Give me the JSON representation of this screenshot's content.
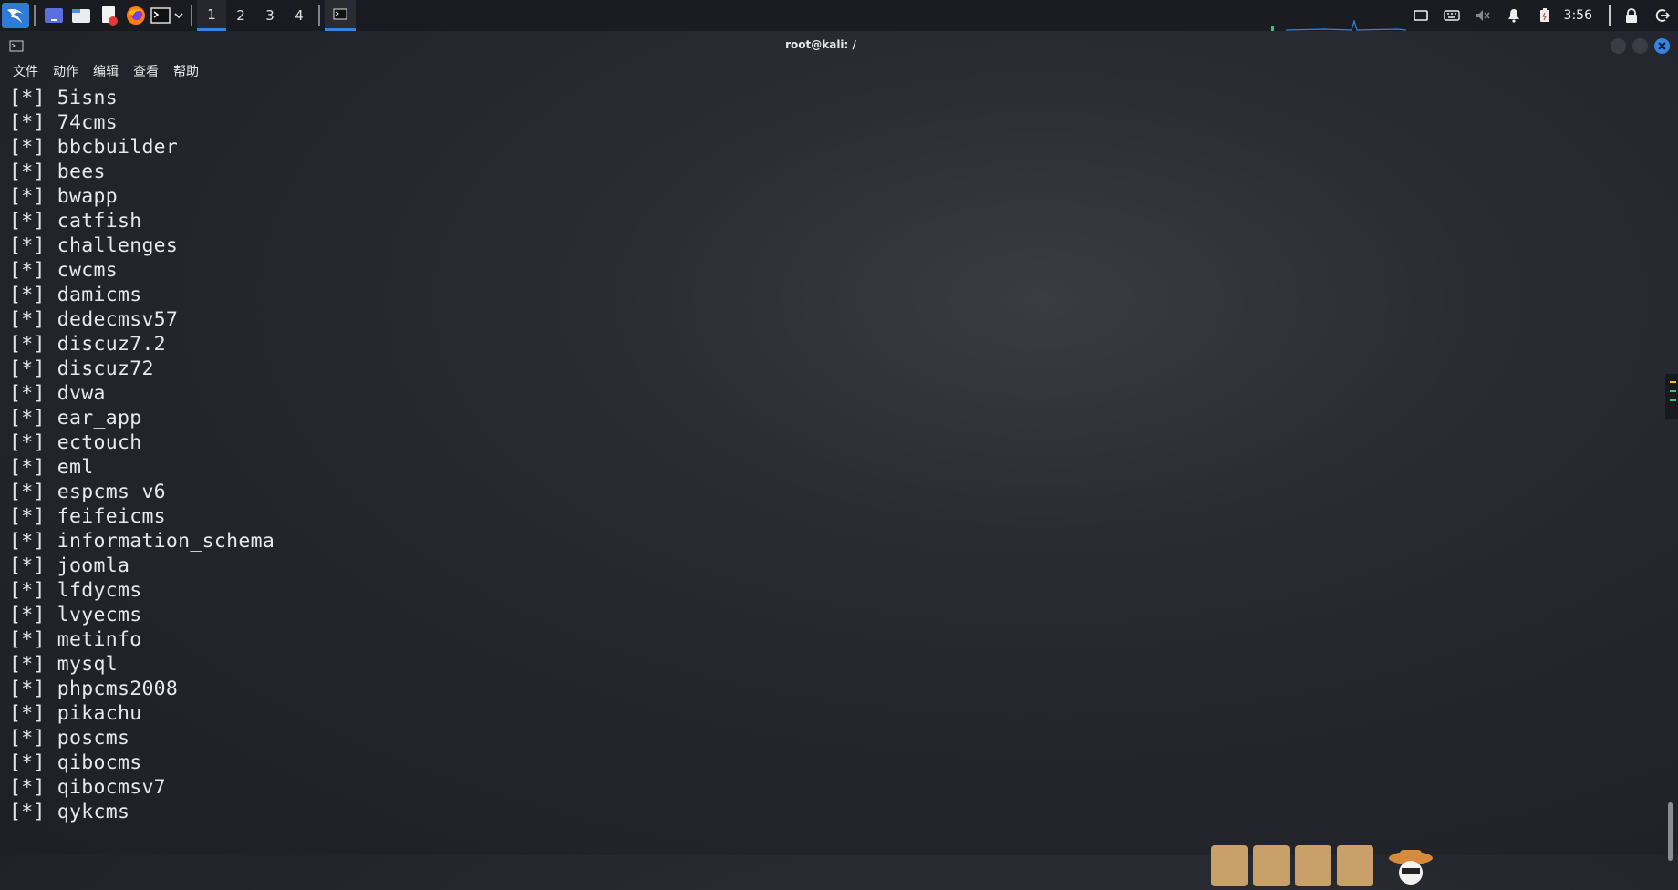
{
  "taskbar": {
    "workspaces": [
      "1",
      "2",
      "3",
      "4"
    ],
    "active_workspace": "1",
    "clock": "3:56",
    "accent_color": "#3584e4"
  },
  "window": {
    "title": "root@kali: /",
    "menu": [
      "文件",
      "动作",
      "编辑",
      "查看",
      "帮助"
    ]
  },
  "terminal": {
    "prefix": "[*]",
    "lines": [
      "5isns",
      "74cms",
      "bbcbuilder",
      "bees",
      "bwapp",
      "catfish",
      "challenges",
      "cwcms",
      "damicms",
      "dedecmsv57",
      "discuz7.2",
      "discuz72",
      "dvwa",
      "ear_app",
      "ectouch",
      "eml",
      "espcms_v6",
      "feifeicms",
      "information_schema",
      "joomla",
      "lfdycms",
      "lvyecms",
      "metinfo",
      "mysql",
      "phpcms2008",
      "pikachu",
      "poscms",
      "qibocms",
      "qibocmsv7",
      "qykcms"
    ]
  },
  "icons": {
    "panel": [
      "kali-menu-icon",
      "desktop-icon",
      "file-manager-icon",
      "text-editor-icon",
      "firefox-icon",
      "terminal-icon",
      "chevron-down-icon"
    ],
    "tray": [
      "display-icon",
      "keyboard-icon",
      "volume-muted-icon",
      "bell-icon",
      "battery-icon",
      "lock-icon",
      "logout-icon"
    ]
  }
}
